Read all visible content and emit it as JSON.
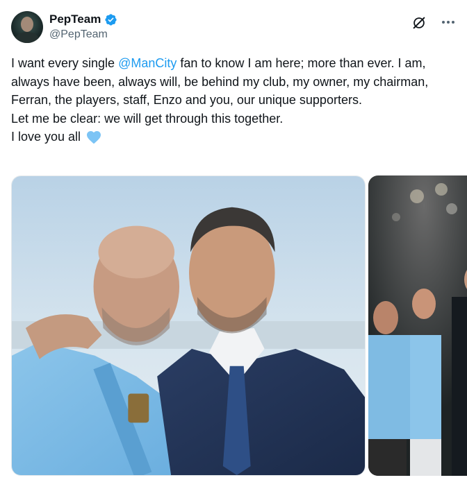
{
  "author": {
    "display_name": "PepTeam",
    "handle": "@PepTeam",
    "avatar_icon": "profile-photo",
    "verified_icon": "verified-badge-icon",
    "verified_color": "#1d9bf0"
  },
  "header_actions": {
    "grok_icon": "grok-icon",
    "more_icon": "more-options-icon"
  },
  "tweet": {
    "line1_before": "I want every single ",
    "mention": "@ManCity",
    "line1_after": " fan to know I am here; more than ever. I am, always have been, always will, be behind my club, my owner, my chairman, Ferran, the players, staff, Enzo and you, our unique supporters.",
    "line2": "Let me be clear: we will get through this together.",
    "line3": "I love you all",
    "emoji": "light-blue-heart",
    "heart_color": "#7cc4f5",
    "mention_color": "#1d9bf0"
  },
  "media": {
    "photo1_description_icon": "tweet-photo-1",
    "photo2_description_icon": "tweet-photo-2"
  }
}
